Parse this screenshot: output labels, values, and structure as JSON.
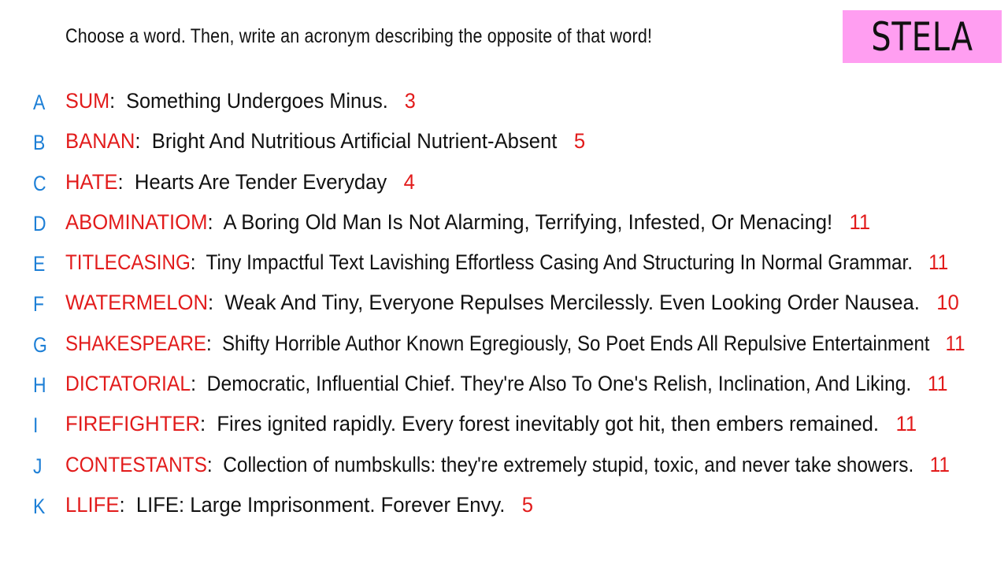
{
  "prompt": "Choose a word. Then, write an acronym describing the opposite of that word!",
  "badge": "STELA",
  "colors": {
    "letter": "#1d7fd6",
    "word": "#e21b1b",
    "score": "#e21b1b",
    "text": "#111111",
    "badge_bg": "#ff9ef1"
  },
  "entries": [
    {
      "letter": "A",
      "word": "SUM",
      "desc": "Something Undergoes Minus.",
      "score": "3"
    },
    {
      "letter": "B",
      "word": "BANAN",
      "desc": "Bright And Nutritious Artificial Nutrient-Absent",
      "score": "5"
    },
    {
      "letter": "C",
      "word": "HATE",
      "desc": "Hearts Are Tender Everyday",
      "score": "4"
    },
    {
      "letter": "D",
      "word": "ABOMINATIOM",
      "desc": "A Boring Old Man Is Not Alarming, Terrifying, Infested, Or Menacing!",
      "score": "11"
    },
    {
      "letter": "E",
      "word": "TITLECASING",
      "desc": "Tiny Impactful Text Lavishing Effortless Casing And Structuring In Normal Grammar.",
      "score": "11"
    },
    {
      "letter": "F",
      "word": "WATERMELON",
      "desc": "Weak And Tiny, Everyone Repulses Mercilessly. Even Looking Order Nausea.",
      "score": "10"
    },
    {
      "letter": "G",
      "word": "SHAKESPEARE",
      "desc": "Shifty Horrible Author Known Egregiously, So Poet Ends All Repulsive Entertainment",
      "score": "11"
    },
    {
      "letter": "H",
      "word": "DICTATORIAL",
      "desc": "Democratic, Influential Chief. They're Also To One's Relish, Inclination, And Liking.",
      "score": "11"
    },
    {
      "letter": "I",
      "word": "FIREFIGHTER",
      "desc": "Fires ignited rapidly. Every forest inevitably got hit, then embers remained.",
      "score": "11"
    },
    {
      "letter": "J",
      "word": "CONTESTANTS",
      "desc": "Collection of numbskulls: they're extremely stupid, toxic, and never take showers.",
      "score": "11"
    },
    {
      "letter": "K",
      "word": "LLIFE",
      "desc": "LIFE: Large Imprisonment. Forever Envy.",
      "score": "5"
    }
  ]
}
